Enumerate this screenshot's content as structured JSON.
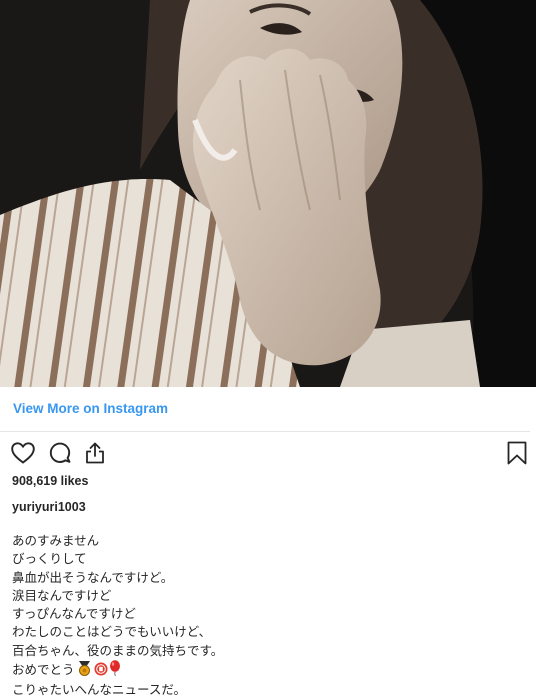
{
  "post": {
    "photo": {
      "icon": "selfie-photo"
    },
    "view_more_label": "View More on Instagram",
    "actions": {
      "like_icon": "heart-icon",
      "comment_icon": "comment-bubble-icon",
      "share_icon": "share-upload-icon",
      "save_icon": "bookmark-icon"
    },
    "likes": "908,619 likes",
    "username": "yuriyuri1003",
    "caption_lines": [
      "あのすみません",
      "びっくりして",
      "鼻血が出そうなんですけど。",
      "涙目なんですけど",
      "すっぴんなんですけど",
      "わたしのことはどうでもいいけど、",
      "百合ちゃん、役のままの気持ちです。",
      "おめでとう",
      "こりゃたいへんなニュースだ。"
    ],
    "caption_emojis": [
      "sports-medal-icon",
      "congratulations-seal-icon",
      "red-balloon-icon"
    ],
    "colors": {
      "link": "#3897f0",
      "text": "#262626",
      "divider": "#e6e6e6"
    }
  }
}
